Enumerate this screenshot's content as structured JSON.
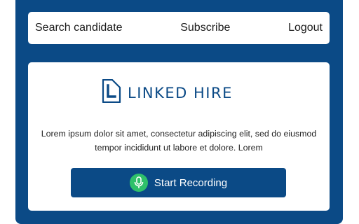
{
  "nav": {
    "search_label": "Search candidate",
    "subscribe_label": "Subscribe",
    "logout_label": "Logout"
  },
  "brand": {
    "name": "LINKED HIRE",
    "logo_icon": "linked-hire-logo-icon",
    "color": "#0b4a86"
  },
  "main": {
    "description": "Lorem ipsum dolor sit amet, consectetur adipiscing elit, sed do eiusmod tempor incididunt ut labore et dolore. Lorem",
    "record_button": {
      "label": "Start Recording",
      "icon": "microphone-icon",
      "icon_bg": "#2fc06a"
    }
  }
}
